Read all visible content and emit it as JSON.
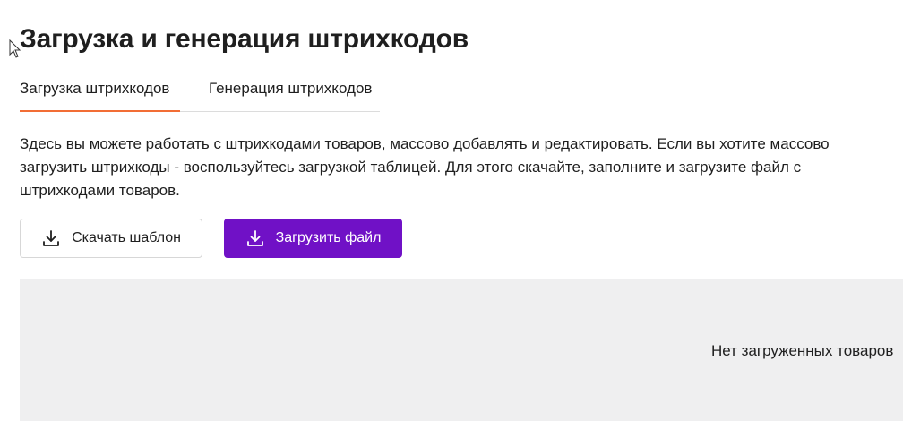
{
  "page": {
    "title": "Загрузка и генерация штрихкодов"
  },
  "tabs": [
    {
      "label": "Загрузка штрихкодов",
      "active": true
    },
    {
      "label": "Генерация штрихкодов",
      "active": false
    }
  ],
  "description": "Здесь вы можете работать с штрихкодами товаров, массово добавлять и редактировать. Если вы хотите массово загрузить штрихкоды - воспользуйтесь загрузкой таблицей. Для этого скачайте, заполните и загрузите файл с штрихкодами товаров.",
  "actions": {
    "download_template_label": "Скачать шаблон",
    "download_template_icon": "download-icon",
    "upload_file_label": "Загрузить файл",
    "upload_file_icon": "upload-icon"
  },
  "empty_state": {
    "text": "Нет загруженных товаров"
  },
  "colors": {
    "accent_purple": "#7011c6",
    "tab_underline": "#f26d35",
    "empty_background": "#efeff0"
  }
}
